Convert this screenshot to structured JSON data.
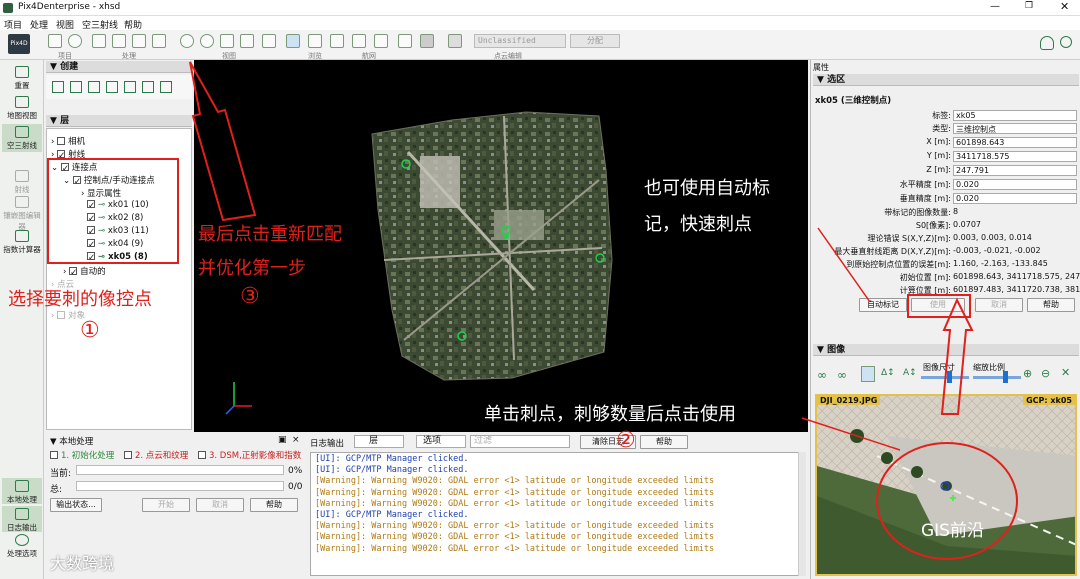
{
  "window_title": "Pix4Denterprise - xhsd",
  "menu": [
    "项目",
    "处理",
    "视图",
    "空三射线",
    "帮助"
  ],
  "toolbar_groups": [
    "项目",
    "处理",
    "视图",
    "浏览",
    "航网",
    "点云编辑"
  ],
  "toolbar_class_value": "Unclassified",
  "toolbar_assign": "分配",
  "leftnav": [
    "重置",
    "地图视图",
    "空三射线",
    "射线",
    "镶嵌图编辑器",
    "指数计算器"
  ],
  "leftnav_bottom": [
    "本地处理",
    "日志输出",
    "处理选项"
  ],
  "create_header": "创建",
  "layers_header": "层",
  "layer_tree": [
    {
      "label": "相机",
      "level": 0,
      "checked": false
    },
    {
      "label": "射线",
      "level": 0,
      "checked": true
    },
    {
      "label": "连接点",
      "level": 0,
      "checked": true
    },
    {
      "label": "控制点/手动连接点",
      "level": 1,
      "checked": true
    },
    {
      "label": "显示属性",
      "level": 2,
      "checked": null
    },
    {
      "label": "xk01 (10)",
      "level": 2,
      "checked": true
    },
    {
      "label": "xk02 (8)",
      "level": 2,
      "checked": true
    },
    {
      "label": "xk03 (11)",
      "level": 2,
      "checked": true
    },
    {
      "label": "xk04 (9)",
      "level": 2,
      "checked": true
    },
    {
      "label": "xk05 (8)",
      "level": 2,
      "checked": true,
      "bold": true
    },
    {
      "label": "自动的",
      "level": 1,
      "checked": true
    },
    {
      "label": "点云",
      "level": 0,
      "checked": null
    },
    {
      "label": "对象",
      "level": 0,
      "checked": null
    }
  ],
  "properties": {
    "header": "属性",
    "section": "选区",
    "title": "xk05 (三维控制点)",
    "rows": [
      {
        "label": "标签:",
        "value": "xk05",
        "type": "input"
      },
      {
        "label": "类型:",
        "value": "三维控制点",
        "type": "select"
      },
      {
        "label": "X [m]:",
        "value": "601898.643",
        "type": "input"
      },
      {
        "label": "Y [m]:",
        "value": "3411718.575",
        "type": "input"
      },
      {
        "label": "Z [m]:",
        "value": "247.791",
        "type": "input"
      },
      {
        "label": "水平精度 [m]:",
        "value": "0.020",
        "type": "input"
      },
      {
        "label": "垂直精度 [m]:",
        "value": "0.020",
        "type": "input"
      },
      {
        "label": "带标记的图像数量:",
        "value": "8",
        "type": "text"
      },
      {
        "label": "S0[像素]:",
        "value": "0.0707",
        "type": "text"
      },
      {
        "label": "理论错误 S(X,Y,Z)[m]:",
        "value": "0.003, 0.003, 0.014",
        "type": "text"
      },
      {
        "label": "最大垂直射线距离 D(X,Y,Z)[m]:",
        "value": "-0.003, -0.021, -0.002",
        "type": "text"
      },
      {
        "label": "到原始控制点位置的误差[m]:",
        "value": "1.160, -2.163, -133.845",
        "type": "text"
      },
      {
        "label": "初始位置 [m]:",
        "value": "601898.643, 3411718.575, 247",
        "type": "text"
      },
      {
        "label": "计算位置 [m]:",
        "value": "601897.483, 3411720.738, 381",
        "type": "text"
      }
    ],
    "buttons": {
      "auto": "自动标记",
      "use": "使用",
      "cancel": "取消",
      "help": "帮助"
    }
  },
  "images": {
    "header": "图像",
    "size_label": "图像尺寸",
    "zoom_label": "缩放比例",
    "image_name": "DJI_0219.JPG",
    "gcp_label": "GCP: xk05"
  },
  "local_processing": {
    "header": "本地处理",
    "steps": [
      "1. 初始化处理",
      "2. 点云和纹理",
      "3. DSM,正射影像和指数"
    ],
    "current_label": "当前:",
    "current_pct": "0%",
    "total_label": "总:",
    "total_count": "0/0",
    "output_btn": "输出状态...",
    "start_btn": "开始",
    "cancel_btn": "取消",
    "help_btn": "帮助"
  },
  "log": {
    "header": "日志输出",
    "level": "层",
    "options": "选项",
    "filter_placeholder": "过滤",
    "clear": "清除日志",
    "help": "帮助",
    "lines": [
      {
        "text": "[UI]: GCP/MTP Manager clicked.",
        "kind": "info"
      },
      {
        "text": "[UI]: GCP/MTP Manager clicked.",
        "kind": "info"
      },
      {
        "text": "[Warning]: Warning W9020:  GDAL error <1> latitude or longitude exceeded limits",
        "kind": "warn"
      },
      {
        "text": "[Warning]: Warning W9020:  GDAL error <1> latitude or longitude exceeded limits",
        "kind": "warn"
      },
      {
        "text": "[Warning]: Warning W9020:  GDAL error <1> latitude or longitude exceeded limits",
        "kind": "warn"
      },
      {
        "text": "[UI]: GCP/MTP Manager clicked.",
        "kind": "info"
      },
      {
        "text": "[Warning]: Warning W9020:  GDAL error <1> latitude or longitude exceeded limits",
        "kind": "warn"
      },
      {
        "text": "[Warning]: Warning W9020:  GDAL error <1> latitude or longitude exceeded limits",
        "kind": "warn"
      },
      {
        "text": "[Warning]: Warning W9020:  GDAL error <1> latitude or longitude exceeded limits",
        "kind": "warn"
      }
    ]
  },
  "annotations": {
    "a1": "选择要刺的像控点",
    "a3a": "最后点击重新匹配",
    "a3b": "并优化第一步",
    "atop_a": "也可使用自动标",
    "atop_b": "记，快速刺点",
    "a2": "单击刺点，刺够数量后点击使用",
    "n1": "①",
    "n2": "②",
    "n3": "③"
  },
  "watermarks": {
    "left": "大数跨境",
    "right": "GIS前沿"
  },
  "colors": {
    "annotation": "#e0201c",
    "accent": "#2f7a4a",
    "info_log": "#1f3fb0",
    "warn_log": "#b07a14"
  }
}
